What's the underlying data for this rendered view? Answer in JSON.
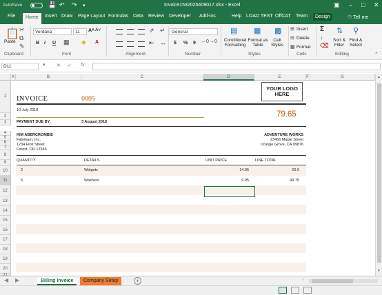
{
  "titlebar": {
    "autosave": "AutoSave",
    "toggle_state": "Off",
    "window_title": "Invoice1532025409017.xlsx  -  Excel",
    "save_icon": "save-icon",
    "undo_icon": "undo-icon",
    "redo_icon": "redo-icon"
  },
  "tabs": [
    "File",
    "Home",
    "Insert",
    "Draw",
    "Page Layout",
    "Formulas",
    "Data",
    "Review",
    "Developer",
    "Add-ins",
    "Help",
    "LOAD TEST",
    "OffCAT",
    "Team",
    "Design"
  ],
  "tellme": "Tell me",
  "ribbon": {
    "clipboard": {
      "paste": "Paste",
      "label": "Clipboard"
    },
    "font": {
      "name": "Verdana",
      "size": "11",
      "bold": "B",
      "italic": "I",
      "underline": "U",
      "label": "Font"
    },
    "alignment": {
      "label": "Alignment"
    },
    "number": {
      "format": "General",
      "currency": "$",
      "percent": "%",
      "comma": "9",
      "label": "Number"
    },
    "styles": {
      "conditional": "Conditional Formatting",
      "format_table": "Format as Table",
      "cell_styles": "Cell Styles",
      "label": "Styles"
    },
    "cells": {
      "insert": "Insert",
      "delete": "Delete",
      "format": "Format",
      "label": "Cells"
    },
    "editing": {
      "sortfilter": "Sort & Filter",
      "findselect": "Find & Select",
      "sigma": "Σ",
      "label": "Editing"
    }
  },
  "formula_bar": {
    "namebox": "D11",
    "fx": "fx",
    "formula": ""
  },
  "columns": [
    "A",
    "B",
    "C",
    "D",
    "E",
    "F",
    "G"
  ],
  "rows": [
    "1",
    "2",
    "3",
    "4",
    "5",
    "6",
    "7",
    "8",
    "9",
    "10",
    "11",
    "12",
    "13",
    "14",
    "15",
    "16",
    "17",
    "18",
    "19",
    "20",
    "21",
    "22"
  ],
  "invoice": {
    "title": "INVOICE",
    "number": "0005",
    "date": "19 July 2018",
    "total": "79.65",
    "due_label": "PAYMENT DUE BY:",
    "due_date": "3 August 2018",
    "logo_line1": "YOUR LOGO",
    "logo_line2": "HERE",
    "bill_name": "KIM ABERCROMBIE",
    "bill_company": "Fabrikam, Inc.",
    "bill_street": "1234 First Street",
    "bill_city": "Forest, OR 12345",
    "from_name": "ADVENTURE WORKS",
    "from_street": "23456 Maple Street",
    "from_city": "Orange Grove, CA 09876",
    "headers": {
      "quantity": "QUANTITY",
      "details": "DETAILS",
      "unit_price": "UNIT PRICE",
      "line_total": "LINE TOTAL"
    },
    "items": [
      {
        "qty": "2",
        "details": "Widgets",
        "price": "14.95",
        "total": "29.9"
      },
      {
        "qty": "5",
        "details": "Washers",
        "price": "9.95",
        "total": "49.75"
      }
    ]
  },
  "sheet_tabs": [
    "Billing Invoice",
    "Company Setup"
  ],
  "colors": {
    "excel_green": "#217346",
    "accent_orange": "#c55a11",
    "tab_orange": "#ed7d31",
    "stripe": "#f9f1e9"
  }
}
